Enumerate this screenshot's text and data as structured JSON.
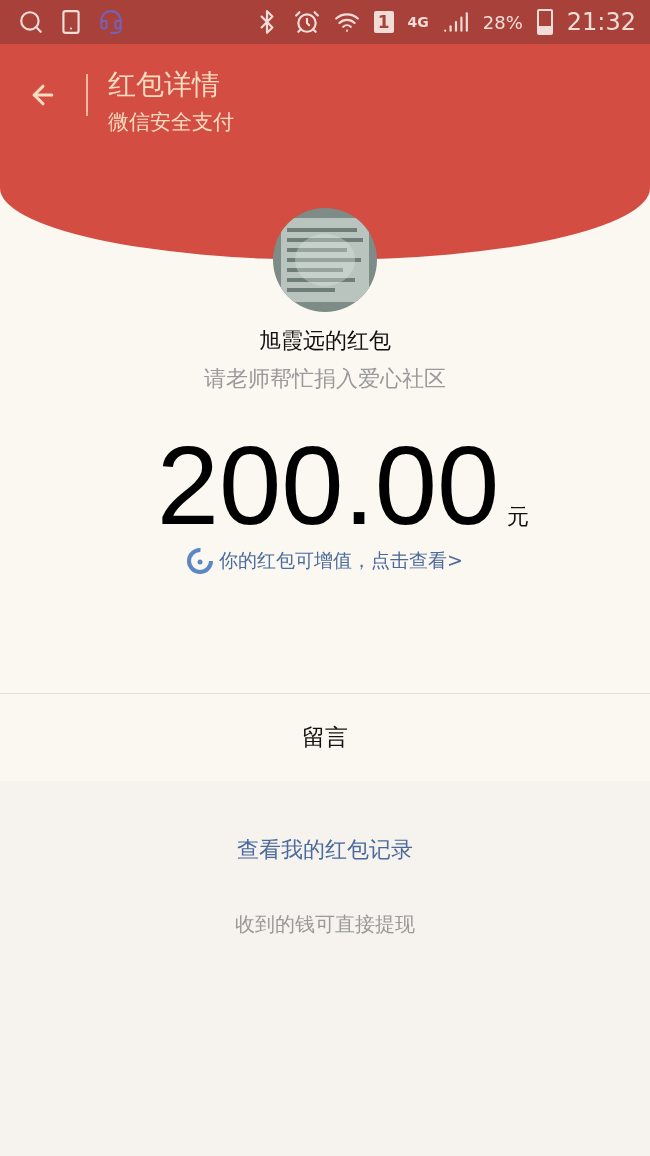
{
  "status_bar": {
    "sim_slot": "1",
    "network": "4G",
    "battery": "28%",
    "time": "21:32"
  },
  "header": {
    "title": "红包详情",
    "subtitle": "微信安全支付"
  },
  "packet": {
    "sender_title": "旭霞远的红包",
    "message": "请老师帮忙捐入爱心社区",
    "amount": "200.00",
    "currency": "元",
    "upgrade_link": "你的红包可增值，点击查看>"
  },
  "reply_button": "留言",
  "records_link": "查看我的红包记录",
  "note": "收到的钱可直接提现"
}
